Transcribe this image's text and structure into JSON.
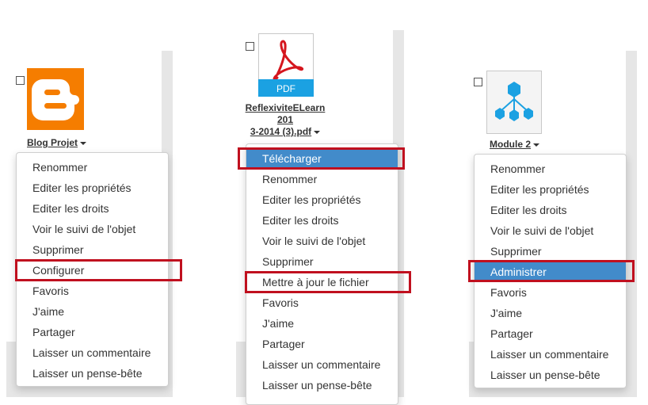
{
  "colors": {
    "highlight_border": "#c0101f",
    "active_item_bg": "#428bca",
    "blogger_orange": "#f57d00",
    "pdf_red": "#d5161e",
    "pdf_band_blue": "#1ba1e2",
    "module_blue": "#1ba1e2"
  },
  "cards": [
    {
      "name": "Blog Projet",
      "icon": "blogger-icon",
      "menu": [
        {
          "label": "Renommer"
        },
        {
          "label": "Editer les propriétés"
        },
        {
          "label": "Editer les droits"
        },
        {
          "label": "Voir le suivi de l'objet"
        },
        {
          "label": "Supprimer"
        },
        {
          "label": "Configurer",
          "highlighted": true
        },
        {
          "label": "Favoris"
        },
        {
          "label": "J'aime"
        },
        {
          "label": "Partager"
        },
        {
          "label": "Laisser un commentaire"
        },
        {
          "label": "Laisser un pense-bête"
        }
      ]
    },
    {
      "name_lines": [
        "ReflexiviteELearn",
        "201",
        "3-2014 (3).pdf"
      ],
      "icon": "pdf-file-icon",
      "icon_band_label": "PDF",
      "menu": [
        {
          "label": "Télécharger",
          "active": true,
          "highlighted": true
        },
        {
          "label": "Renommer"
        },
        {
          "label": "Editer les propriétés"
        },
        {
          "label": "Editer les droits"
        },
        {
          "label": "Voir le suivi de l'objet"
        },
        {
          "label": "Supprimer"
        },
        {
          "label": "Mettre à jour le fichier",
          "highlighted": true
        },
        {
          "label": "Favoris"
        },
        {
          "label": "J'aime"
        },
        {
          "label": "Partager"
        },
        {
          "label": "Laisser un commentaire"
        },
        {
          "label": "Laisser un pense-bête"
        }
      ]
    },
    {
      "name": "Module 2",
      "icon": "module-hierarchy-icon",
      "menu": [
        {
          "label": "Renommer"
        },
        {
          "label": "Editer les propriétés"
        },
        {
          "label": "Editer les droits"
        },
        {
          "label": "Voir le suivi de l'objet"
        },
        {
          "label": "Supprimer"
        },
        {
          "label": "Administrer",
          "active": true,
          "highlighted": true
        },
        {
          "label": "Favoris"
        },
        {
          "label": "J'aime"
        },
        {
          "label": "Partager"
        },
        {
          "label": "Laisser un commentaire"
        },
        {
          "label": "Laisser un pense-bête"
        }
      ]
    }
  ]
}
